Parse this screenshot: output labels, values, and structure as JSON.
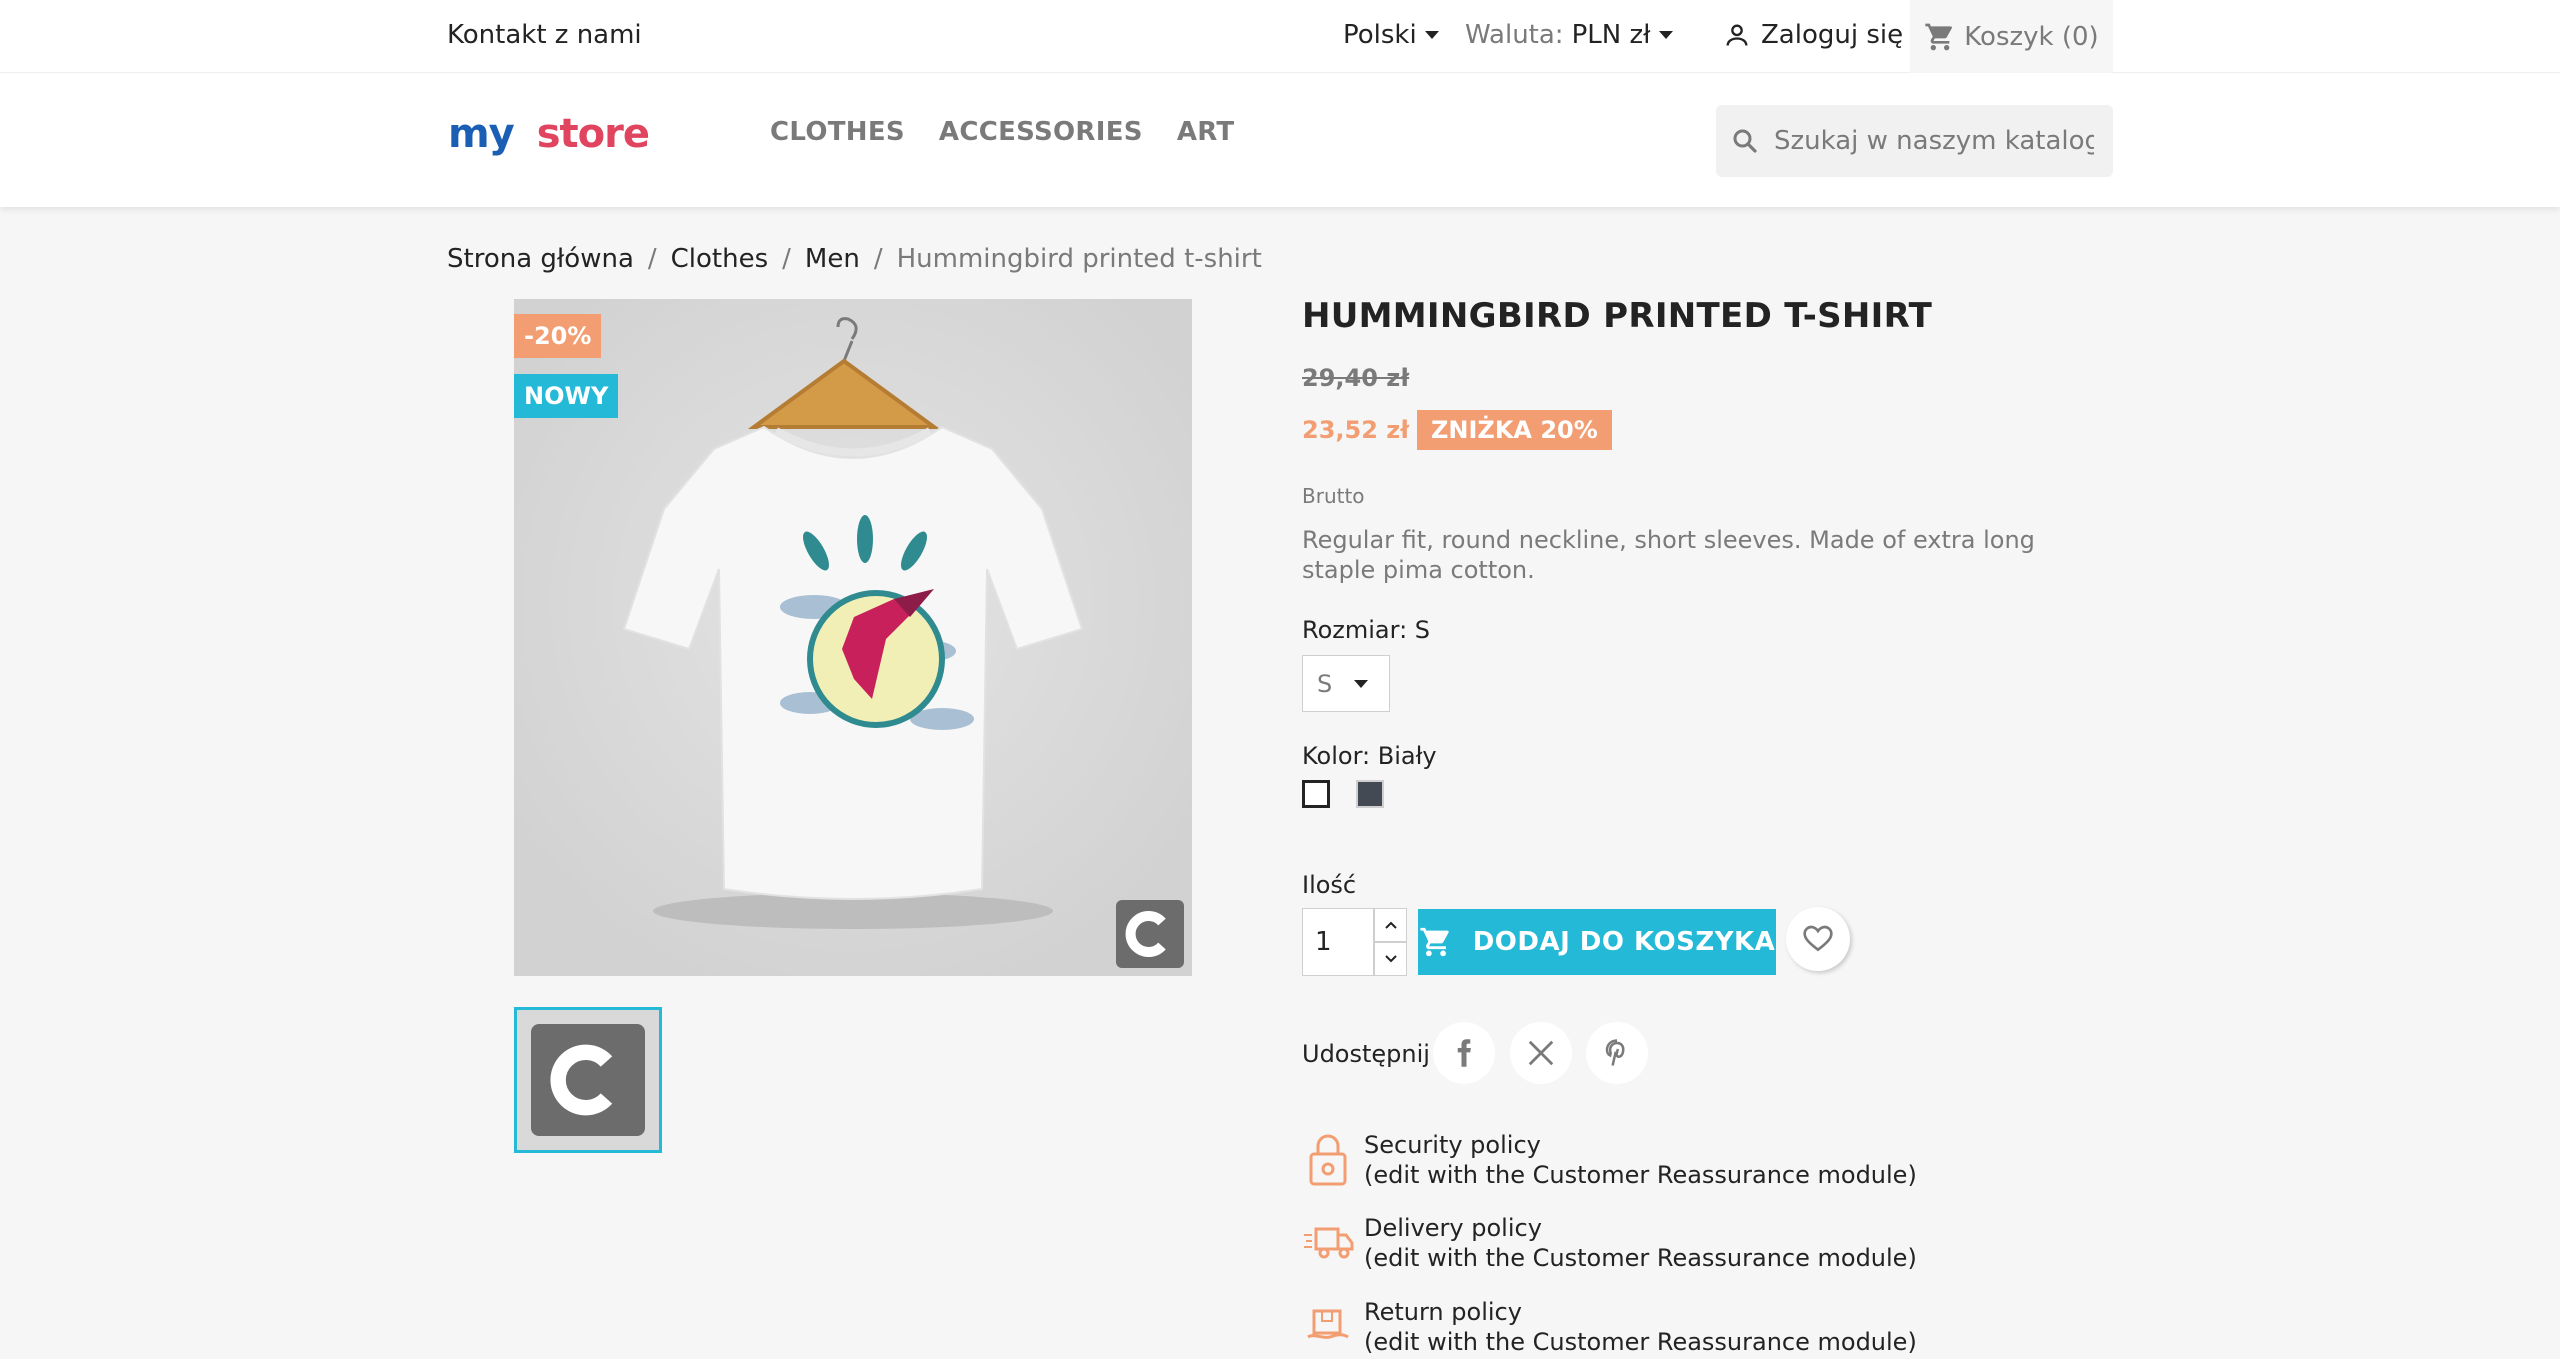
{
  "topbar": {
    "contact": "Kontakt z nami",
    "language": "Polski",
    "currency_label": "Waluta:",
    "currency_value": "PLN zł",
    "login": "Zaloguj się",
    "cart": "Koszyk (0)"
  },
  "header": {
    "logo_word1": "my",
    "logo_word2": "store",
    "menu": [
      "CLOTHES",
      "ACCESSORIES",
      "ART"
    ],
    "search_placeholder": "Szukaj w naszym katalogu"
  },
  "breadcrumb": [
    "Strona główna",
    "Clothes",
    "Men",
    "Hummingbird printed t-shirt"
  ],
  "breadcrumb_sep": "/",
  "product": {
    "badge_discount": "-20%",
    "badge_new": "NOWY",
    "title": "HUMMINGBIRD PRINTED T-SHIRT",
    "old_price": "29,40 zł",
    "new_price": "23,52 zł",
    "discount_tag": "ZNIŻKA 20%",
    "tax_label": "Brutto",
    "description": "Regular fit, round neckline, short sleeves. Made of extra long staple pima cotton.",
    "size_label": "Rozmiar: S",
    "size_value": "S",
    "color_label": "Kolor: Biały",
    "colors": [
      "#ffffff",
      "#434a54"
    ],
    "qty_label": "Ilość",
    "qty_value": "1",
    "add_to_cart": "DODAJ DO KOSZYKA",
    "share_label": "Udostępnij"
  },
  "reassurance": [
    {
      "title": "Security policy",
      "sub": "(edit with the Customer Reassurance module)"
    },
    {
      "title": "Delivery policy",
      "sub": "(edit with the Customer Reassurance module)"
    },
    {
      "title": "Return policy",
      "sub": "(edit with the Customer Reassurance module)"
    }
  ],
  "colors": {
    "accent": "#24b9d7",
    "discount": "#f39d72"
  }
}
